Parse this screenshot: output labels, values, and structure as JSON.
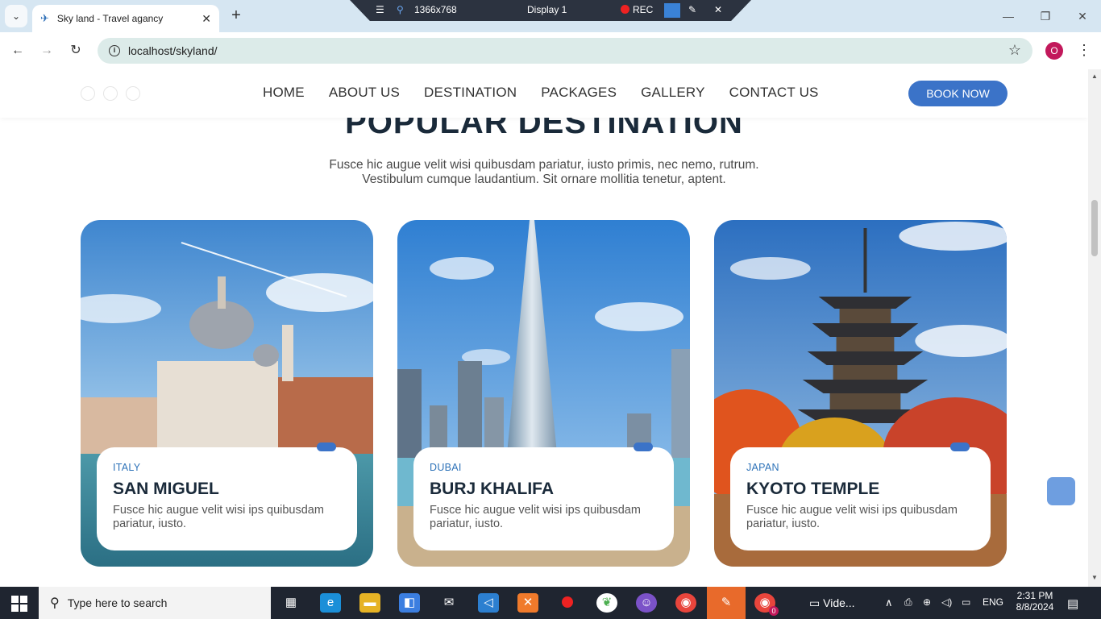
{
  "browser": {
    "tab_title": "Sky land - Travel agancy",
    "url": "localhost/skyland/",
    "profile_initial": "O",
    "recorder": {
      "resolution": "1366x768",
      "display": "Display 1",
      "rec_label": "REC"
    }
  },
  "site": {
    "nav": [
      "HOME",
      "ABOUT US",
      "DESTINATION",
      "PACKAGES",
      "GALLERY",
      "CONTACT US"
    ],
    "book_label": "BOOK NOW",
    "section_title": "POPULAR DESTINATION",
    "section_subtitle": "Fusce hic augue velit wisi quibusdam pariatur, iusto primis, nec nemo, rutrum. Vestibulum cumque laudantium. Sit ornare mollitia tenetur, aptent.",
    "cards": [
      {
        "country": "ITALY",
        "name": "SAN MIGUEL",
        "desc": "Fusce hic augue velit wisi ips quibusdam pariatur, iusto."
      },
      {
        "country": "DUBAI",
        "name": "BURJ KHALIFA",
        "desc": "Fusce hic augue velit wisi ips quibusdam pariatur, iusto."
      },
      {
        "country": "JAPAN",
        "name": "KYOTO TEMPLE",
        "desc": "Fusce hic augue velit wisi ips quibusdam pariatur, iusto."
      }
    ],
    "accent_color": "#3b73c8"
  },
  "taskbar": {
    "search_placeholder": "Type here to search",
    "video_label": "Vide...",
    "language": "ENG",
    "time": "2:31 PM",
    "date": "8/8/2024",
    "chrome_badge": "0"
  }
}
